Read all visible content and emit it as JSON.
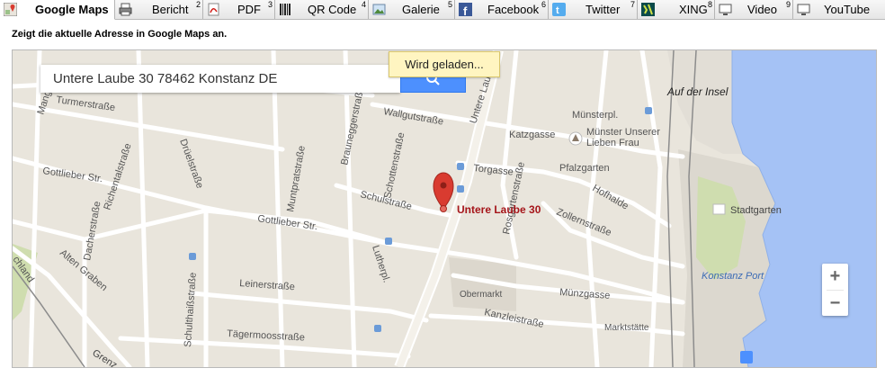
{
  "tabs": [
    {
      "label": "Google Maps",
      "num": "",
      "icon": "google-maps-icon",
      "active": true
    },
    {
      "label": "Bericht",
      "num": "2",
      "icon": "printer-icon"
    },
    {
      "label": "PDF",
      "num": "3",
      "icon": "pdf-icon"
    },
    {
      "label": "QR Code",
      "num": "4",
      "icon": "qr-code-icon"
    },
    {
      "label": "Galerie",
      "num": "5",
      "icon": "gallery-icon"
    },
    {
      "label": "Facebook",
      "num": "6",
      "icon": "facebook-icon"
    },
    {
      "label": "Twitter",
      "num": "7",
      "icon": "twitter-icon"
    },
    {
      "label": "XING",
      "num": "8",
      "icon": "xing-icon"
    },
    {
      "label": "Video",
      "num": "9",
      "icon": "monitor-icon"
    },
    {
      "label": "YouTube",
      "num": "",
      "icon": "monitor-icon"
    }
  ],
  "description": "Zeigt die aktuelle Adresse in Google Maps an.",
  "map": {
    "search_value": "Untere Laube 30 78462 Konstanz DE",
    "loading_text": "Wird geladen...",
    "marker_label": "Untere Laube 30",
    "zoom_in": "+",
    "zoom_out": "−",
    "labels": {
      "auf_der_insel": "Auf der Insel",
      "muensterpl": "Münsterpl.",
      "muenster": "Münster Unserer",
      "lieben_frau": "Lieben Frau",
      "katzgasse": "Katzgasse",
      "wallgutstrasse": "Wallgutstraße",
      "torgasse": "Torgasse",
      "pfalzgarten": "Pfalzgarten",
      "hofhalde": "Hofhalde",
      "zollernstrasse": "Zollernstraße",
      "stadtgarten": "Stadtgarten",
      "konstanz_port": "Konstanz Port",
      "muenzgasse": "Münzgasse",
      "obermarkt": "Obermarkt",
      "kanzleistrasse": "Kanzleistraße",
      "marktstaette": "Marktstätte",
      "schulstrasse": "Schulstraße",
      "gottlieber_str1": "Gottlieber Str.",
      "gottlieber_str2": "Gottlieber Str.",
      "richentalstrasse": "Richentalstraße",
      "dacherstrasse": "Dacherstraße",
      "alten_graben": "Alten Graben",
      "leinerstrasse": "Leinerstraße",
      "schulthaissstrasse": "Schulthaißstraße",
      "taegermoosstrasse": "Tägermoosstraße",
      "muntpratstrasse": "Muntpratstraße",
      "brauneggerstrasse": "Brauneggerstraße",
      "schottenstrasse": "Schottenstraße",
      "untere_laube": "Untere Laube",
      "turmerstrasse": "Turmerstraße",
      "drueelstrasse": "Drüelstraße",
      "luthepl": "Lutherpl.",
      "grenz": "Grenz",
      "mango": "Mango",
      "chland": "chland",
      "rosgarten": "Rosgartenstraße"
    }
  },
  "colors": {
    "accent": "#4d90fe",
    "marker": "#d93b30",
    "marker_label": "#a5151a",
    "water": "#a5c2f5",
    "park": "#cfddaf",
    "loading_bg": "#fff5c1"
  }
}
